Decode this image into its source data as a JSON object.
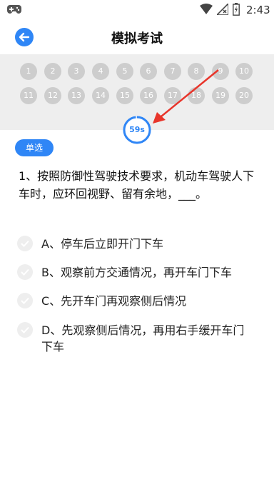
{
  "status_bar": {
    "time": "2:43",
    "icons": [
      "gamepad-icon",
      "wifi-icon",
      "cellular-no-signal-icon",
      "battery-charging-icon"
    ]
  },
  "header": {
    "back_icon": "arrow-left-icon",
    "title": "模拟考试"
  },
  "question_grid": {
    "numbers": [
      "1",
      "2",
      "3",
      "4",
      "5",
      "6",
      "7",
      "8",
      "9",
      "10",
      "11",
      "12",
      "13",
      "14",
      "15",
      "16",
      "17",
      "18",
      "19",
      "20"
    ]
  },
  "timer": {
    "text": "59s",
    "progress": 0.983
  },
  "question": {
    "type_label": "单选",
    "text": "1、按照防御性驾驶技术要求，机动车驾驶人下车时，应环回视野、留有余地，___。",
    "options": [
      "A、停车后立即开门下车",
      "B、观察前方交通情况，再开车门下车",
      "C、先开车门再观察侧后情况",
      "D、先观察侧后情况，再用右手缓开车门下车"
    ]
  },
  "colors": {
    "accent": "#2f86f6",
    "grid_bg": "#eeeeee",
    "number_bg": "#cdcdcd",
    "arrow": "#e8352b"
  }
}
